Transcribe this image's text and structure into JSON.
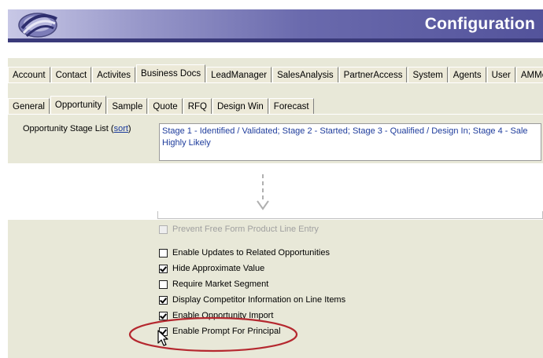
{
  "header": {
    "title": "Configuration"
  },
  "main_tabs": [
    {
      "label": "Account"
    },
    {
      "label": "Contact"
    },
    {
      "label": "Activites"
    },
    {
      "label": "Business Docs",
      "active": true
    },
    {
      "label": "LeadManager"
    },
    {
      "label": "SalesAnalysis"
    },
    {
      "label": "PartnerAccess"
    },
    {
      "label": "System"
    },
    {
      "label": "Agents"
    },
    {
      "label": "User"
    },
    {
      "label": "AMMobile"
    }
  ],
  "sub_tabs": [
    {
      "label": "General"
    },
    {
      "label": "Opportunity",
      "active": true
    },
    {
      "label": "Sample"
    },
    {
      "label": "Quote"
    },
    {
      "label": "RFQ"
    },
    {
      "label": "Design Win"
    },
    {
      "label": "Forecast"
    }
  ],
  "stage_list": {
    "label": "Opportunity Stage List",
    "sort_link": "sort",
    "value_line1": "Stage 1 - Identified / Validated; Stage 2 - Started; Stage 3 - Qualified / Design In; Stage 4 - Sale",
    "value_line2": "Highly Likely"
  },
  "options": [
    {
      "label": "Prevent Free Form Product Line Entry",
      "checked": false,
      "disabled": true
    },
    {
      "label": "Enable Updates to Related Opportunities",
      "checked": false
    },
    {
      "label": "Hide Approximate Value",
      "checked": true
    },
    {
      "label": "Require Market Segment",
      "checked": false
    },
    {
      "label": "Display Competitor Information on Line Items",
      "checked": true
    },
    {
      "label": "Enable Opportunity Import",
      "checked": true
    },
    {
      "label": "Enable Prompt For Principal",
      "checked": true
    }
  ],
  "colors": {
    "banner_dark": "#53539b",
    "highlight_ellipse": "#b5282f",
    "link": "#1a3a9a"
  }
}
